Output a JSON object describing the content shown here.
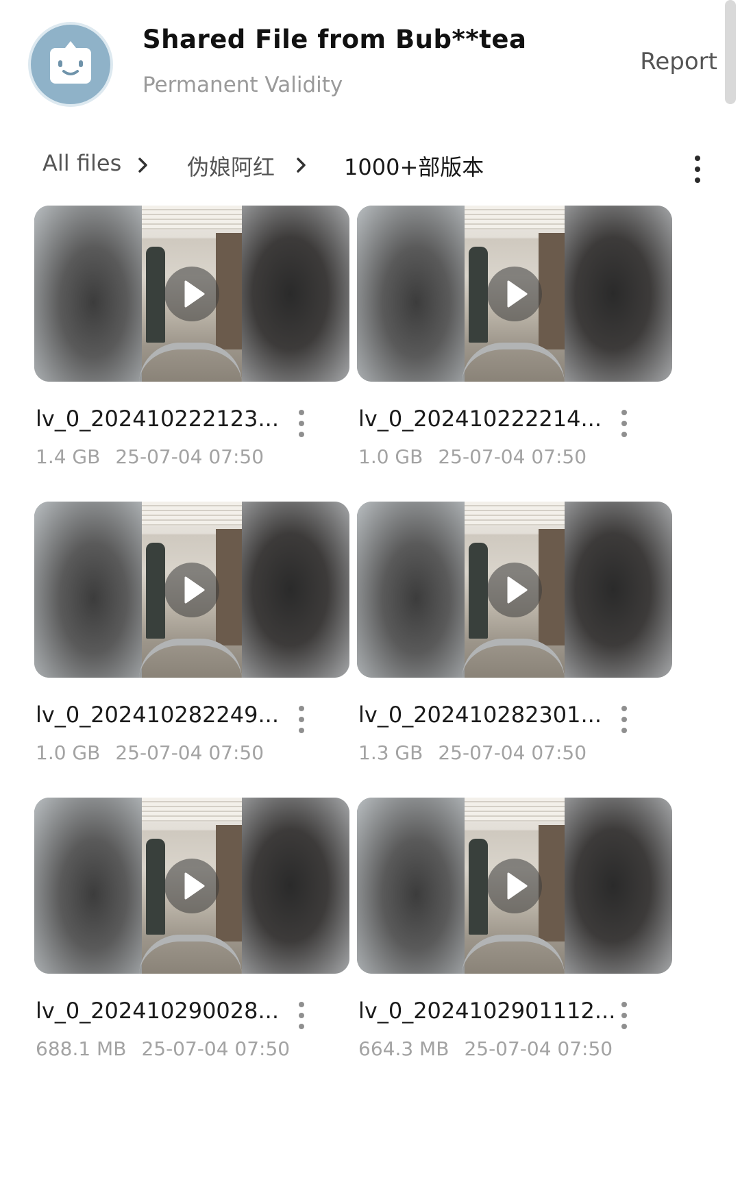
{
  "header": {
    "title": "Shared File from Bub**tea",
    "subtitle": "Permanent Validity",
    "report_label": "Report",
    "avatar_icon": "robot-face-icon",
    "avatar_color": "#8fb2c8"
  },
  "breadcrumb": {
    "items": [
      "All files",
      "伪娘阿红",
      "1000+部版本"
    ],
    "separator_icon": "chevron-right-icon",
    "more_icon": "more-vertical-icon"
  },
  "files": [
    {
      "name": "lv_0_202410222123...",
      "size": "1.4 GB",
      "date": "25-07-04 07:50",
      "type": "video"
    },
    {
      "name": "lv_0_202410222214...",
      "size": "1.0 GB",
      "date": "25-07-04 07:50",
      "type": "video"
    },
    {
      "name": "lv_0_202410282249...",
      "size": "1.0 GB",
      "date": "25-07-04 07:50",
      "type": "video"
    },
    {
      "name": "lv_0_202410282301...",
      "size": "1.3 GB",
      "date": "25-07-04 07:50",
      "type": "video"
    },
    {
      "name": "lv_0_202410290028...",
      "size": "688.1 MB",
      "date": "25-07-04 07:50",
      "type": "video"
    },
    {
      "name": "lv_0_2024102901112...",
      "size": "664.3 MB",
      "date": "25-07-04 07:50",
      "type": "video"
    }
  ]
}
